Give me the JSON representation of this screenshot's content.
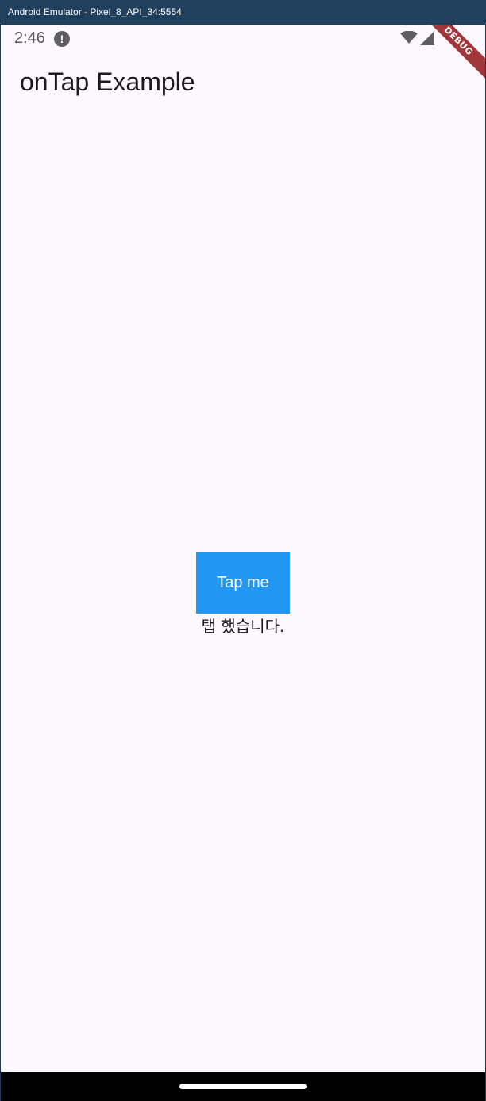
{
  "window": {
    "title": "Android Emulator - Pixel_8_API_34:5554"
  },
  "status_bar": {
    "time": "2:46",
    "alert_glyph": "!",
    "icons": [
      "alert-icon",
      "wifi-icon",
      "signal-icon"
    ]
  },
  "debug_banner": {
    "label": "DEBUG",
    "color": "#a1373a"
  },
  "app_bar": {
    "title": "onTap Example"
  },
  "main": {
    "button_label": "Tap me",
    "button_color": "#2196f3",
    "result_text": "탭 했습니다."
  },
  "colors": {
    "background": "#fdf7fe",
    "text": "#1d1b20"
  }
}
